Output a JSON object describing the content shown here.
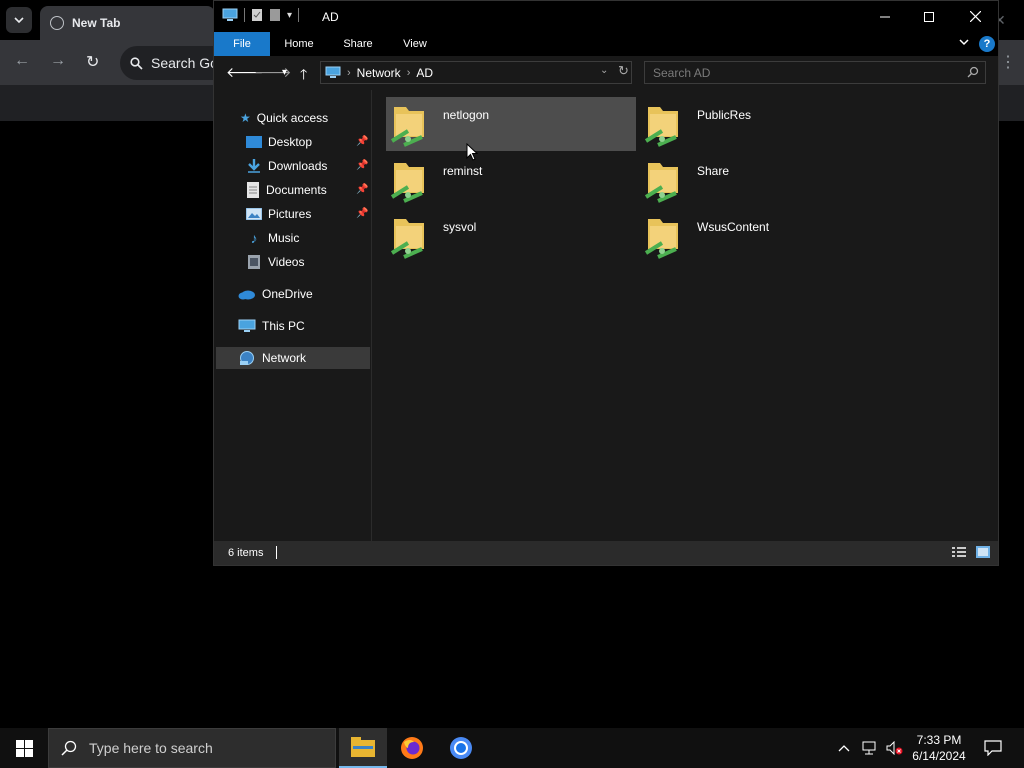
{
  "chrome": {
    "tab_title": "New Tab",
    "omnibox_text": "Search Goo"
  },
  "explorer": {
    "title": "AD",
    "ribbon_tabs": [
      "File",
      "Home",
      "Share",
      "View"
    ],
    "address": {
      "crumbs": [
        "Network",
        "AD"
      ]
    },
    "search_placeholder": "Search AD",
    "nav_pane": {
      "quick_access": "Quick access",
      "items": [
        {
          "label": "Desktop",
          "pinned": true
        },
        {
          "label": "Downloads",
          "pinned": true
        },
        {
          "label": "Documents",
          "pinned": true
        },
        {
          "label": "Pictures",
          "pinned": true
        },
        {
          "label": "Music",
          "pinned": false
        },
        {
          "label": "Videos",
          "pinned": false
        }
      ],
      "onedrive": "OneDrive",
      "this_pc": "This PC",
      "network": "Network",
      "selected": "Network"
    },
    "shares": [
      "netlogon",
      "PublicRes",
      "reminst",
      "Share",
      "sysvol",
      "WsusContent"
    ],
    "hovered_share": "netlogon",
    "status": "6 items"
  },
  "taskbar": {
    "search_placeholder": "Type here to search",
    "apps": [
      "file-explorer",
      "firefox",
      "chrome"
    ],
    "active_app": "file-explorer",
    "time": "7:33 PM",
    "date": "6/14/2024"
  },
  "colors": {
    "accent": "#1979ca",
    "explorer_bg": "#191919",
    "taskbar_bg": "#101010",
    "folder": "#e8c35a",
    "network_cable": "#4caf50"
  }
}
